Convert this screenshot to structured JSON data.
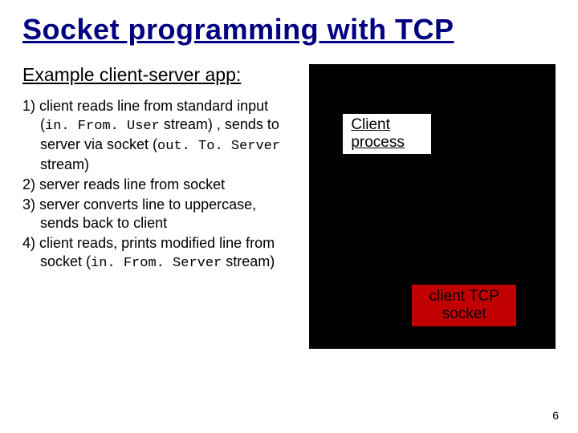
{
  "title": "Socket programming with TCP",
  "subhead": "Example client-server app:",
  "steps": [
    {
      "num": "1)",
      "pre": "client reads line from standard input (",
      "code1": "in. From. User",
      "mid1": " stream) , sends to server via socket (",
      "code2": "out. To. Server",
      "post": " stream)"
    },
    {
      "num": "2)",
      "pre": "server reads line from socket",
      "code1": "",
      "mid1": "",
      "code2": "",
      "post": ""
    },
    {
      "num": "3)",
      "pre": "server converts line to uppercase, sends back to client",
      "code1": "",
      "mid1": "",
      "code2": "",
      "post": ""
    },
    {
      "num": "4)",
      "pre": "client reads, prints  modified line from socket (",
      "code1": "in. From. Server",
      "mid1": " stream)",
      "code2": "",
      "post": ""
    }
  ],
  "diagram": {
    "client_process": "Client process",
    "tcp_socket": "client TCP socket"
  },
  "page_number": "6"
}
